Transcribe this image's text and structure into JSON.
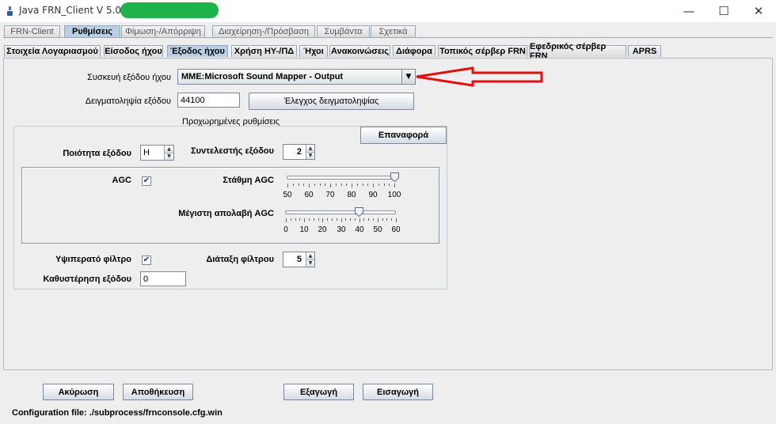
{
  "window": {
    "title": "Java FRN_Client V 5.00.8 -",
    "minimize_glyph": "—",
    "maximize_glyph": "☐",
    "close_glyph": "✕"
  },
  "main_tabs": [
    {
      "label": "FRN-Client",
      "selected": false
    },
    {
      "label": "Ρυθμίσεις",
      "selected": true
    },
    {
      "label": "Φίμωση-/Απόρριψη",
      "selected": false
    },
    {
      "label": "Διαχείρηση-/Πρόσβαση",
      "selected": false
    },
    {
      "label": "Συμβάντα",
      "selected": false
    },
    {
      "label": "Σχετικά",
      "selected": false
    }
  ],
  "sub_tabs": [
    {
      "label": "Στοιχεία Λογαριασμού",
      "selected": false
    },
    {
      "label": "Είσοδος ήχου",
      "selected": false
    },
    {
      "label": "Έξοδος ήχου",
      "selected": true
    },
    {
      "label": "Χρήση ΗΥ-/ΠΔ",
      "selected": false
    },
    {
      "label": "Ήχοι",
      "selected": false
    },
    {
      "label": "Ανακοινώσεις",
      "selected": false
    },
    {
      "label": "Διάφορα",
      "selected": false
    },
    {
      "label": "Τοπικός σέρβερ FRN",
      "selected": false
    },
    {
      "label": "Εφεδρικός σέρβερ FRN",
      "selected": false
    },
    {
      "label": "APRS",
      "selected": false
    }
  ],
  "output": {
    "device_label": "Συσκευή εξόδου ήχου",
    "device_value": "MME:Microsoft Sound Mapper - Output",
    "sample_rate_label": "Δειγματοληψία εξόδου",
    "sample_rate_value": "44100",
    "test_sampling_button": "Έλεγχος δειγματοληψίας"
  },
  "advanced": {
    "title": "Προχωρημένες ρυθμίσεις",
    "reset_button": "Επαναφορά",
    "quality_label": "Ποιότητα εξόδου",
    "quality_value": "H",
    "factor_label": "Συντελεστής εξόδου",
    "factor_value": "2",
    "agc_label": "AGC",
    "agc_checked": true,
    "agc_level_label": "Στάθμη AGC",
    "agc_level_ticks": [
      "50",
      "60",
      "70",
      "80",
      "90",
      "100"
    ],
    "agc_level_value": 100,
    "max_gain_label": "Μέγιστη απολαβή AGC",
    "max_gain_ticks": [
      "0",
      "10",
      "20",
      "30",
      "40",
      "50",
      "60"
    ],
    "max_gain_value": 40,
    "highpass_label": "Υψιπερατό φίλτρο",
    "highpass_checked": true,
    "filter_order_label": "Διάταξη φίλτρου",
    "filter_order_value": "5",
    "delay_label": "Καθυστέρηση εξόδου",
    "delay_value": "0"
  },
  "footer": {
    "cancel_button": "Ακύρωση",
    "save_button": "Αποθήκευση",
    "export_button": "Εξαγωγή",
    "import_button": "Εισαγωγή",
    "config_file": "Configuration file: ./subprocess/frnconsole.cfg.win"
  },
  "colors": {
    "annotation_arrow": "#e01010",
    "selected_tab": "#b8cfe5",
    "redaction": "#1db34a"
  }
}
